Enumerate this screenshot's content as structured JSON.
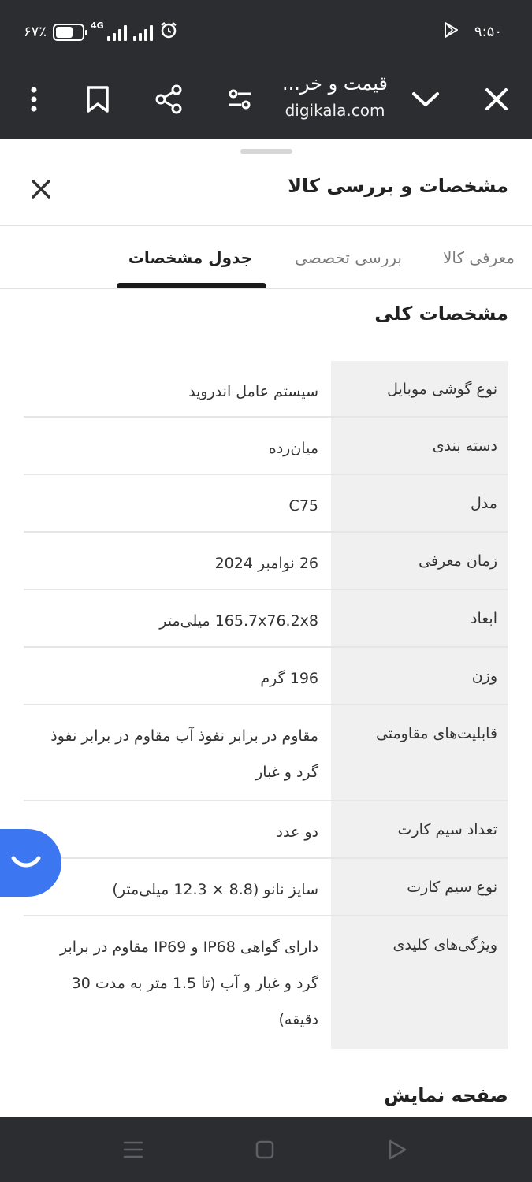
{
  "status_bar": {
    "battery_text": "۶۷٪",
    "battery_level": 0.67,
    "network": "4G",
    "time": "۹:۵۰"
  },
  "browser": {
    "page_title": "قیمت و خر...",
    "url": "digikala.com",
    "icons": [
      "close-icon",
      "chevron-down-icon",
      "tune-icon",
      "share-icon",
      "bookmark-icon",
      "more-vert-icon"
    ]
  },
  "sheet": {
    "title": "مشخصات و بررسی کالا",
    "tabs": [
      {
        "label": "معرفی کالا",
        "active": false
      },
      {
        "label": "بررسی تخصصی",
        "active": false
      },
      {
        "label": "جدول مشخصات",
        "active": true
      }
    ],
    "section_title": "مشخصات کلی",
    "specs": [
      {
        "label": "نوع گوشی موبایل",
        "value": "سیستم عامل اندروید"
      },
      {
        "label": "دسته بندی",
        "value": "میان‌رده"
      },
      {
        "label": "مدل",
        "value": "C75"
      },
      {
        "label": "زمان معرفی",
        "value": "26 نوامبر 2024"
      },
      {
        "label": "ابعاد",
        "value": "165.7x76.2x8 میلی‌متر"
      },
      {
        "label": "وزن",
        "value": "196 گرم"
      },
      {
        "label": "قابلیت‌های مقاومتی",
        "value": "مقاوم در برابر نفوذ آب مقاوم در برابر نفوذ گرد و غبار"
      },
      {
        "label": "تعداد سیم کارت",
        "value": "دو عدد"
      },
      {
        "label": "نوع سیم کارت",
        "value": "سایز نانو (8.8 × 12.3 میلی‌متر)"
      },
      {
        "label": "ویژگی‌های کلیدی",
        "value": "دارای گواهی IP68 و IP69 مقاوم در برابر گرد و غبار و آب (تا 1.5 متر به مدت 30 دقیقه)"
      }
    ],
    "next_section_title": "صفحه نمایش"
  },
  "colors": {
    "bar_bg": "#2c2d30",
    "accent_fab": "#3c76f0",
    "label_bg": "#f0f0f1"
  }
}
